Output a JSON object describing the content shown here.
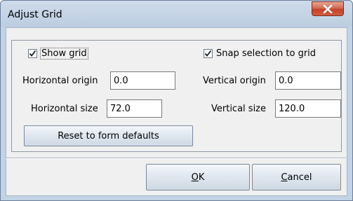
{
  "window": {
    "title": "Adjust Grid",
    "close_icon": "close-x-icon",
    "colors": {
      "frame": "#c3d3e6",
      "client": "#f0f0f0",
      "close_button": "#c9492f"
    }
  },
  "options": {
    "show_grid": {
      "label": "Show grid",
      "checked": true
    },
    "snap_to_grid": {
      "label": "Snap selection to grid",
      "checked": true
    }
  },
  "fields": {
    "horizontal_origin": {
      "label": "Horizontal origin",
      "value": "0.0"
    },
    "vertical_origin": {
      "label": "Vertical origin",
      "value": "0.0"
    },
    "horizontal_size": {
      "label": "Horizontal size",
      "value": "72.0"
    },
    "vertical_size": {
      "label": "Vertical size",
      "value": "120.0"
    }
  },
  "buttons": {
    "reset": "Reset to form defaults",
    "ok": {
      "mnemonic": "O",
      "rest": "K"
    },
    "cancel": {
      "mnemonic": "C",
      "rest": "ancel"
    }
  }
}
